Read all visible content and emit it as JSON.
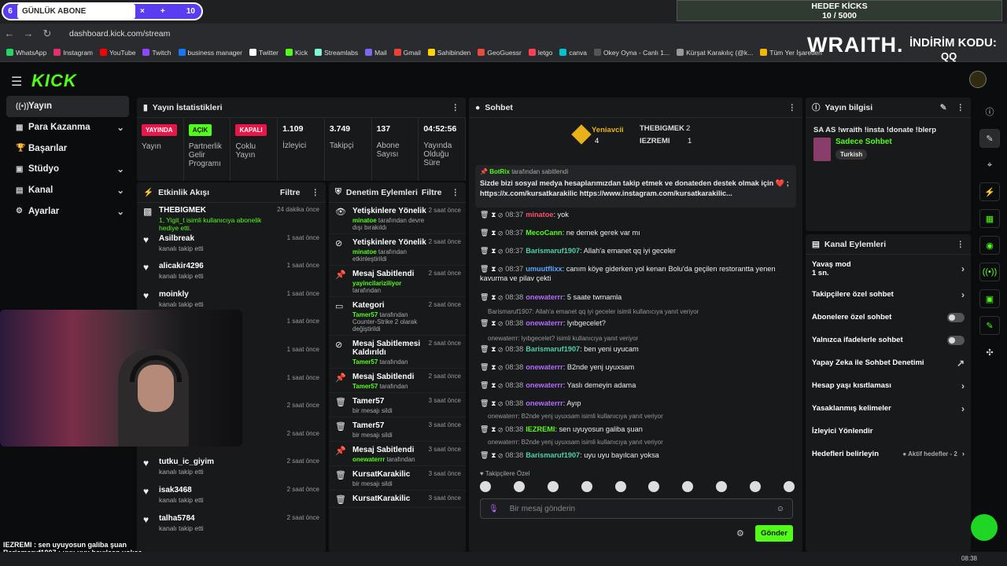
{
  "subbar": {
    "num_left": "6",
    "label": "GÜNLÜK ABONE",
    "num_right": "10"
  },
  "goal": {
    "title": "HEDEF KİCKS",
    "progress": "10 / 5000"
  },
  "browser": {
    "url": "dashboard.kick.com/stream",
    "bookmarks": [
      "WhatsApp",
      "Instagram",
      "YouTube",
      "Twitch",
      "business manager",
      "Twitter",
      "Kick",
      "Streamlabs",
      "Mail",
      "Gmail",
      "Sahibinden",
      "GeoGuessr",
      "letgo",
      "canva",
      "Okey Oyna - Canlı 1...",
      "Kürşat Karakılıç (@k...",
      "Tüm Yer İşaretleri"
    ]
  },
  "overlay": {
    "brand": "WRAITH.",
    "code_label": "İNDİRİM KODU:",
    "code": "QQ"
  },
  "logo": "KICK",
  "sidebar": [
    {
      "label": "Yayın",
      "icon": "stream-icon",
      "active": true
    },
    {
      "label": "Para Kazanma",
      "icon": "money-icon",
      "chev": true
    },
    {
      "label": "Başarılar",
      "icon": "trophy-icon"
    },
    {
      "label": "Stüdyo",
      "icon": "studio-icon",
      "chev": true
    },
    {
      "label": "Kanal",
      "icon": "channel-icon",
      "chev": true
    },
    {
      "label": "Ayarlar",
      "icon": "gear-icon",
      "chev": true
    }
  ],
  "stats": {
    "title": "Yayın İstatistikleri",
    "items": [
      {
        "badge": "YAYINDA",
        "label": "Yayın"
      },
      {
        "badge": "AÇIK",
        "label": "Partnerlik Gelir Programı"
      },
      {
        "badge": "KAPALI",
        "label": "Çoklu Yayın"
      },
      {
        "value": "1.109",
        "label": "İzleyici"
      },
      {
        "value": "3.749",
        "label": "Takipçi"
      },
      {
        "value": "137",
        "label": "Abone Sayısı"
      },
      {
        "value": "04:52:56",
        "label": "Yayında Olduğu Süre"
      }
    ]
  },
  "activity": {
    "title": "Etkinlik Akışı",
    "filter": "Filtre",
    "items": [
      {
        "name": "THEBIGMEK",
        "sub": "1, Yigit_t isimli kullanıcıya abonelik hediye etti.",
        "time": "24 dakika önce"
      },
      {
        "name": "Asilbreak",
        "sub": "kanalı takip etti",
        "time": "1 saat önce"
      },
      {
        "name": "alicakir4296",
        "sub": "kanalı takip etti",
        "time": "1 saat önce"
      },
      {
        "name": "moinkly",
        "sub": "kanalı takip etti",
        "time": "1 saat önce"
      },
      {
        "name": "",
        "sub": "",
        "time": "1 saat önce"
      },
      {
        "name": "",
        "sub": "",
        "time": "1 saat önce"
      },
      {
        "name": "",
        "sub": "",
        "time": "1 saat önce"
      },
      {
        "name": "",
        "sub": "",
        "time": "2 saat önce"
      },
      {
        "name": "",
        "sub": "kanalı takip etti",
        "time": "2 saat önce"
      },
      {
        "name": "tutku_ic_giyim",
        "sub": "kanalı takip etti",
        "time": "2 saat önce"
      },
      {
        "name": "isak3468",
        "sub": "kanalı takip etti",
        "time": "2 saat önce"
      },
      {
        "name": "talha5784",
        "sub": "kanalı takip etti",
        "time": "2 saat önce"
      }
    ]
  },
  "moderation": {
    "title": "Denetim Eylemleri",
    "filter": "Filtre",
    "items": [
      {
        "name": "Yetişkinlere Yönelik",
        "user": "minatoe",
        "sub": " tarafından devre dışı bırakıldı",
        "time": "2 saat önce"
      },
      {
        "name": "Yetişkinlere Yönelik",
        "user": "minatoe",
        "sub": " tarafından etkinleştirildi",
        "time": "2 saat önce"
      },
      {
        "name": "Mesaj Sabitlendi",
        "user": "yayincilariziliyor",
        "sub": " tarafından",
        "time": "2 saat önce"
      },
      {
        "name": "Kategori",
        "user": "Tamer57",
        "sub": " tarafından Counter-Strike 2 olarak değiştirildi",
        "time": "2 saat önce"
      },
      {
        "name": "Mesaj Sabitlemesi Kaldırıldı",
        "user": "Tamer57",
        "sub": " tarafından",
        "time": "2 saat önce"
      },
      {
        "name": "Mesaj Sabitlendi",
        "user": "Tamer57",
        "sub": " tarafından",
        "time": "2 saat önce"
      },
      {
        "name": "Tamer57",
        "user": "",
        "sub": "bir mesajı sildi",
        "time": "3 saat önce"
      },
      {
        "name": "Tamer57",
        "user": "",
        "sub": "bir mesajı sildi",
        "time": "3 saat önce"
      },
      {
        "name": "Mesaj Sabitlendi",
        "user": "onewaterrr",
        "sub": " tarafından",
        "time": "3 saat önce"
      },
      {
        "name": "KursatKarakilic",
        "user": "",
        "sub": "bir mesajı sildi",
        "time": "3 saat önce"
      },
      {
        "name": "KursatKarakilic",
        "user": "",
        "sub": "",
        "time": "3 saat önce"
      }
    ]
  },
  "chat": {
    "title": "Sohbet",
    "leaders": {
      "first": {
        "name": "Yeniavcii",
        "count": "4"
      },
      "second": {
        "name": "THEBIGMEK",
        "count": "2"
      },
      "third": {
        "name": "IEZREMI",
        "count": "1"
      }
    },
    "pinned": {
      "by": "BotRix",
      "by_suffix": " tarafından sabitlendi",
      "text": "Sizde bizi sosyal medya hesaplarımızdan takip etmek ve donateden destek olmak için ❤️ ; https://x.com/kursatkarakilic https://www.instagram.com/kursatkarakilic..."
    },
    "messages": [
      {
        "time": "08:37",
        "user": "minatoe",
        "color": "#ff4d6d",
        "text": ": yok"
      },
      {
        "time": "08:37",
        "user": "MecoCann",
        "color": "#53fc18",
        "text": ": ne demek gerek var mı"
      },
      {
        "time": "08:37",
        "user": "Barismaruf1907",
        "color": "#4fd1a5",
        "text": ": Allah'a emanet qq iyi geceler"
      },
      {
        "time": "08:37",
        "user": "umuutflixx",
        "color": "#5aa8ff",
        "text": ": canım köye giderken yol kenarı Bolu'da geçilen restorantta yenen"
      },
      {
        "time": "",
        "user": "",
        "color": "#fff",
        "text": "kavurma ve pilav çekti"
      },
      {
        "time": "08:38",
        "user": "onewaterrr",
        "color": "#b46bff",
        "text": ": 5 saate twmamla"
      },
      {
        "time": "08:38",
        "user": "onewaterrr",
        "color": "#b46bff",
        "text": ": lyıbgecelet?"
      },
      {
        "time": "08:38",
        "user": "Barismaruf1907",
        "color": "#4fd1a5",
        "text": ": ben yeni uyucam"
      },
      {
        "time": "08:38",
        "user": "onewaterrr",
        "color": "#b46bff",
        "text": ": B2nde yenj uyuxsam"
      },
      {
        "time": "08:38",
        "user": "onewaterrr",
        "color": "#b46bff",
        "text": ": Yaslı demeyin adama"
      },
      {
        "time": "08:38",
        "user": "onewaterrr",
        "color": "#b46bff",
        "text": ": Ayıp"
      },
      {
        "time": "08:38",
        "user": "IEZREMI",
        "color": "#53fc18",
        "text": ": sen uyuyosun galiba şuan"
      },
      {
        "time": "08:38",
        "user": "Barismaruf1907",
        "color": "#4fd1a5",
        "text": ": uyu uyu bayılcan yoksa"
      }
    ],
    "replies": [
      "Barismaruf1907: Allah'a emanet qq iyi geceler isimli kullanıcıya yanıt veriyor",
      "onewaterrr: lyıbgecelet? isimli kullanıcıya yanıt veriyor",
      "onewaterrr: B2nde yenj uyuxsam isimli kullanıcıya yanıt veriyor",
      "onewaterrr: B2nde yenj uyuxsam isimli kullanıcıya yanıt veriyor"
    ],
    "followers_only": "Takipçilere Özel",
    "placeholder": "Bir mesaj gönderin",
    "send": "Gönder"
  },
  "streaminfo": {
    "title": "Yayın bilgisi",
    "text": "SA AS !wraith !insta !donate !blerp",
    "category": "Sadece Sohbet",
    "tag": "Turkish"
  },
  "channelactions": {
    "title": "Kanal Eylemleri",
    "items": [
      {
        "label": "Yavaş mod",
        "sub": "1 sn.",
        "kind": "chev"
      },
      {
        "label": "Takipçilere özel sohbet",
        "kind": "chev"
      },
      {
        "label": "Abonelere özel sohbet",
        "kind": "toggle"
      },
      {
        "label": "Yalnızca ifadelerle sohbet",
        "kind": "toggle"
      },
      {
        "label": "Yapay Zeka ile Sohbet Denetimi",
        "kind": "ext"
      },
      {
        "label": "Hesap yaşı kısıtlaması",
        "kind": "chev"
      },
      {
        "label": "Yasaklanmış kelimeler",
        "kind": "chev"
      },
      {
        "label": "İzleyici Yönlendir",
        "kind": "none"
      },
      {
        "label": "Hedefleri belirleyin",
        "kind": "chev",
        "extra": "Aktif hedefler - 2"
      }
    ]
  },
  "overlay_chat": [
    "IEZREMI : sen uyuyosun galiba şuan",
    "Barismaruf1907 : uyu uyu bayılcan yoksa"
  ],
  "taskbar": {
    "clock": "08:38"
  }
}
